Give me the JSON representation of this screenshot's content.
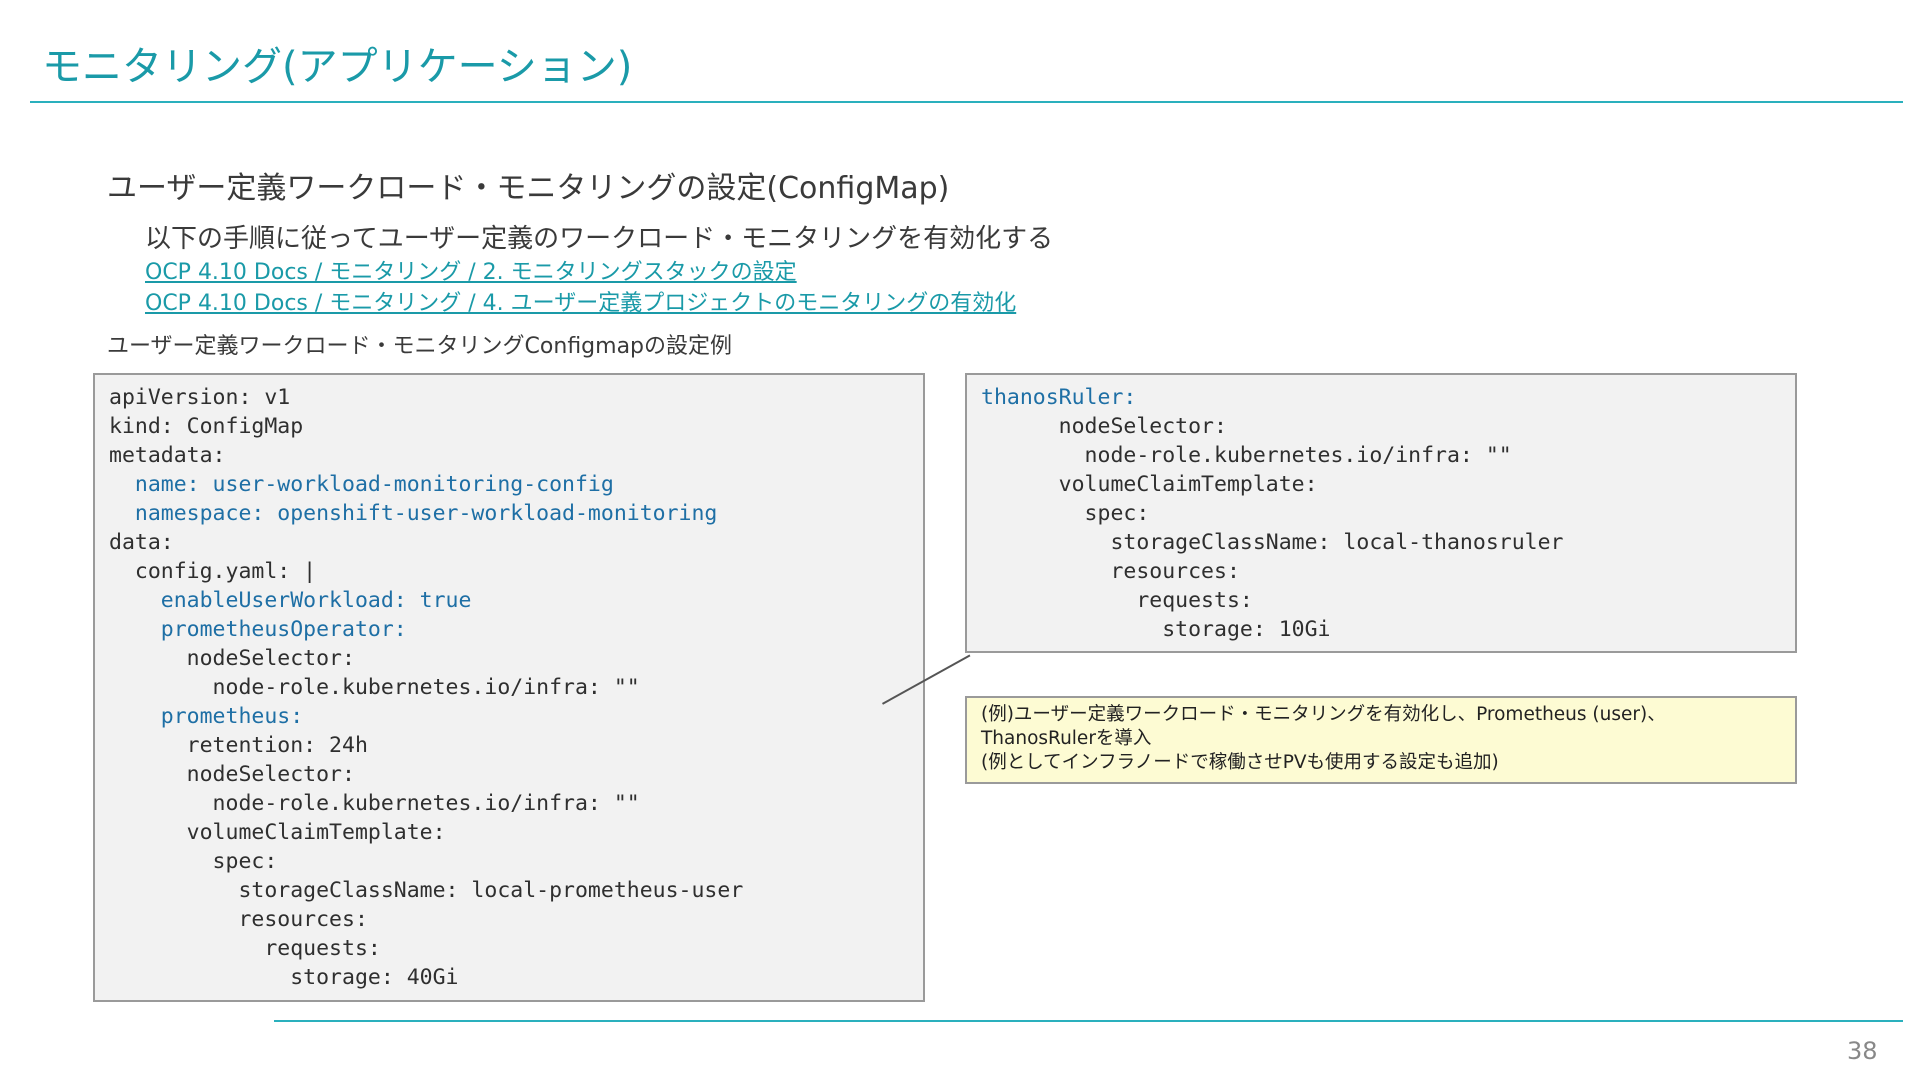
{
  "slide": {
    "title": "モニタリング(アプリケーション)",
    "subtitle": "ユーザー定義ワークロード・モニタリングの設定(ConfigMap)",
    "description": "以下の手順に従ってユーザー定義のワークロード・モニタリングを有効化する",
    "links": [
      "OCP 4.10 Docs / モニタリング / 2. モニタリングスタックの設定",
      "OCP 4.10 Docs / モニタリング / 4. ユーザー定義プロジェクトのモニタリングの有効化"
    ],
    "example_label": "ユーザー定義ワークロード・モニタリングConfigmapの設定例",
    "page_number": "38"
  },
  "code_left": [
    "apiVersion: v1",
    "kind: ConfigMap",
    "metadata:",
    "  name: user-workload-monitoring-config",
    "  namespace: openshift-user-workload-monitoring",
    "data:",
    "  config.yaml: |",
    "    enableUserWorkload: true",
    "    prometheusOperator:",
    "      nodeSelector:",
    "        node-role.kubernetes.io/infra: \"\"",
    "    prometheus:",
    "      retention: 24h",
    "      nodeSelector:",
    "        node-role.kubernetes.io/infra: \"\"",
    "      volumeClaimTemplate:",
    "        spec:",
    "          storageClassName: local-prometheus-user",
    "          resources:",
    "            requests:",
    "              storage: 40Gi"
  ],
  "code_right": [
    "thanosRuler:",
    "      nodeSelector:",
    "        node-role.kubernetes.io/infra: \"\"",
    "      volumeClaimTemplate:",
    "        spec:",
    "          storageClassName: local-thanosruler",
    "          resources:",
    "            requests:",
    "              storage: 10Gi"
  ],
  "note": [
    "(例)ユーザー定義ワークロード・モニタリングを有効化し、Prometheus (user)、",
    "ThanosRulerを導入",
    "(例としてインフラノードで稼働させPVも使用する設定も追加)"
  ],
  "colors": {
    "accent": "#1a9aa8",
    "rule": "#2ab0bd",
    "code_highlight": "#1e6fa5",
    "code_bg": "#f2f2f2",
    "note_bg": "#fdfbd3"
  }
}
